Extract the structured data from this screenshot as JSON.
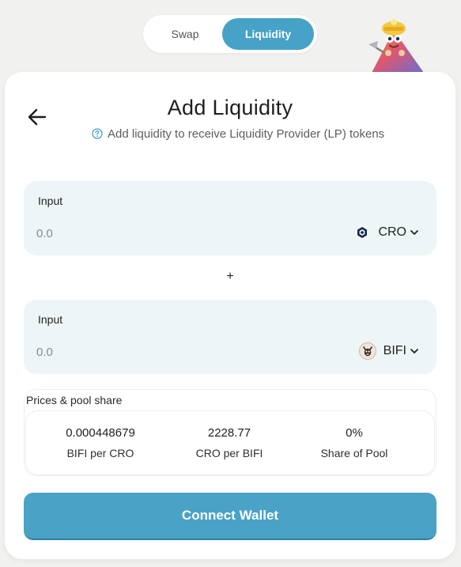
{
  "toggle": {
    "swap_label": "Swap",
    "liquidity_label": "Liquidity",
    "active": "Liquidity"
  },
  "mascot": {
    "icon": "miner-cone-mascot-icon"
  },
  "header": {
    "back_icon": "arrow-left-icon",
    "title": "Add Liquidity",
    "help_icon": "question-circle-icon",
    "subtitle": "Add liquidity to receive Liquidity Provider (LP) tokens"
  },
  "inputs": [
    {
      "label": "Input",
      "placeholder": "0.0",
      "value": "",
      "token": "CRO",
      "token_icon": "cro-token-icon"
    },
    {
      "label": "Input",
      "placeholder": "0.0",
      "value": "",
      "token": "BIFI",
      "token_icon": "bifi-token-icon"
    }
  ],
  "plus_sign": "+",
  "pool": {
    "title": "Prices & pool share",
    "stats": [
      {
        "value": "0.000448679",
        "caption": "BIFI per CRO"
      },
      {
        "value": "2228.77",
        "caption": "CRO per BIFI"
      },
      {
        "value": "0%",
        "caption": "Share of Pool"
      }
    ]
  },
  "connect_label": "Connect Wallet",
  "colors": {
    "accent": "#46a2c6",
    "input_bg": "#eef5f7",
    "page_bg": "#f1f1ef"
  }
}
